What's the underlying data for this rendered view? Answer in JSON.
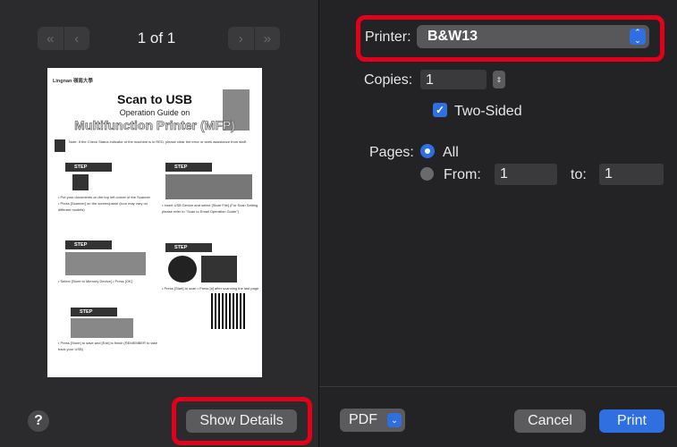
{
  "preview": {
    "page_indicator": "1 of 1",
    "prev_first": "«",
    "prev": "‹",
    "next": "›",
    "next_last": "»",
    "doc": {
      "header": "Lingnan 嶺南大學",
      "title": "Scan to USB",
      "subtitle": "Operation Guide on",
      "title2": "Multifunction Printer (MFP)",
      "note": "Note: If the Check Status indicator of the machine is in RED, please clear the error or seek assistance from staff.",
      "step_label": "STEP",
      "step1_text": "• Put your documents on the top left corner of the Scanner • Press [Scanner] on the screen/panel (icon may vary on different models)",
      "step2_text": "• Insert USB Device and select [Store File] (For Scan Setting please refer to \"Scan to Email Operation Guide\")",
      "step3_text": "• Select [Store to Memory Device] • Press [OK]",
      "step4_text": "• Press [Start] to scan • Press [#] after scanning the last page",
      "step5_text": "• Press [Store] to save and [Exit] to finish (REMEMBER to take back your USB)"
    }
  },
  "footer_left": {
    "help": "?",
    "show_details": "Show Details"
  },
  "settings": {
    "printer_label": "Printer:",
    "printer_value": "B&W13",
    "copies_label": "Copies:",
    "copies_value": "1",
    "two_sided_label": "Two-Sided",
    "pages_label": "Pages:",
    "all_label": "All",
    "from_label": "From:",
    "from_value": "1",
    "to_label": "to:",
    "to_value": "1"
  },
  "footer_right": {
    "pdf": "PDF",
    "cancel": "Cancel",
    "print": "Print"
  },
  "colors": {
    "accent": "#2f6fe0",
    "highlight": "#e3001b"
  }
}
